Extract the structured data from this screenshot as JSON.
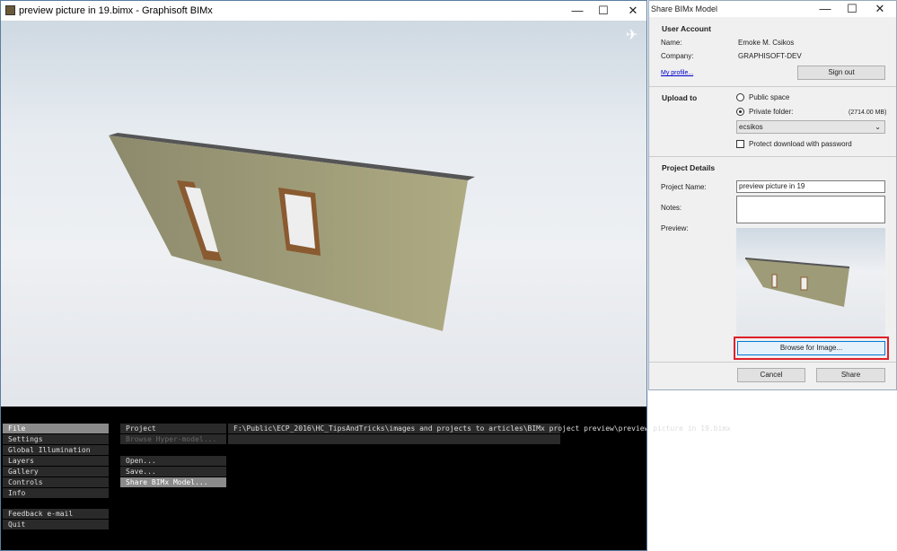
{
  "main_window": {
    "title": "preview picture in 19.bimx - Graphisoft BIMx",
    "minimize": "—",
    "maximize": "☐",
    "close": "✕"
  },
  "viewport": {
    "nav_icon": "airplane-icon"
  },
  "menu": {
    "left": [
      "File",
      "Settings",
      "Global Illumination",
      "Layers",
      "Gallery",
      "Controls",
      "Info"
    ],
    "left_bottom": [
      "Feedback e-mail",
      "Quit"
    ],
    "project_label": "Project",
    "project_path": "F:\\Public\\ECP_2016\\HC_TipsAndTricks\\images and projects to articles\\BIMx project preview\\preview picture in 19.bimx",
    "browse_hyper": "Browse Hyper-model...",
    "actions": [
      "Open...",
      "Save...",
      "Share BIMx Model..."
    ]
  },
  "dialog": {
    "title": "Share BIMx Model",
    "user_account": "User Account",
    "name_label": "Name:",
    "name": "Emoke M. Csikos",
    "company_label": "Company:",
    "company": "GRAPHISOFT-DEV",
    "my_profile": "My profile...",
    "sign_out": "Sign out",
    "upload_to": "Upload to",
    "public_space": "Public space",
    "private_folder": "Private folder:",
    "quota": "(2714.00 MB)",
    "folder": "ecsikos",
    "protect": "Protect download with password",
    "project_details": "Project Details",
    "project_name_label": "Project Name:",
    "project_name": "preview picture in 19",
    "notes_label": "Notes:",
    "notes": "",
    "preview_label": "Preview:",
    "browse": "Browse for Image...",
    "cancel": "Cancel",
    "share": "Share",
    "highlight_color": "#e0202a"
  }
}
